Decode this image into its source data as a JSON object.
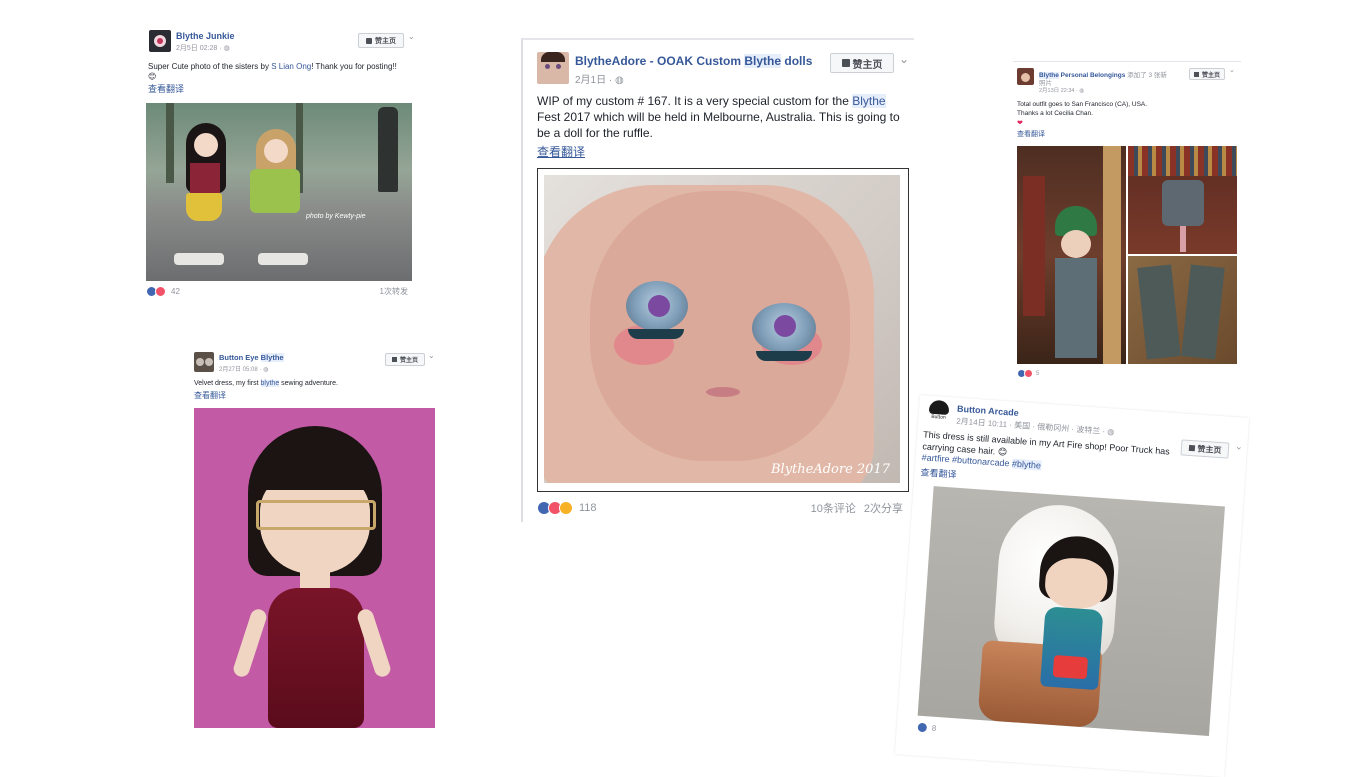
{
  "posts": {
    "junkie": {
      "name": "Blythe Junkie",
      "time": "2月5日 02:28 · ",
      "like_button": "赞主页",
      "text_before": "Super Cute photo of the sisters by ",
      "text_link": "S Lian Ong",
      "text_after": "! Thank you for posting!!",
      "emoji": "😊",
      "translate": "查看翻译",
      "photo_watermark": "photo by Kewty-pie",
      "reaction_count": "42",
      "shares": "1次转发"
    },
    "adore": {
      "name_pre": "BlytheAdore - OOAK Custom ",
      "name_hl": "Blythe",
      "name_post": " dolls",
      "time": "2月1日 · ",
      "like_button": "赞主页",
      "text_before": "WIP of my custom # 167. It is a very special custom for the ",
      "text_hl": "Blythe",
      "text_after": " Fest 2017 which will be held in Melbourne, Australia. This is going to be a doll for the ruffle.",
      "translate": "查看翻译",
      "photo_watermark": "BlytheAdore 2017",
      "reaction_count": "118",
      "comments": "10条评论",
      "shares": "2次分享"
    },
    "personal": {
      "name_hl": "Blythe",
      "name_post": " Personal Belongings",
      "added": "添加了 3 张新",
      "added2": "照片",
      "time": "2月13日 22:34 · ",
      "like_button": "赞主页",
      "line1": "Total outfit goes to San Francisco (CA), USA.",
      "line2": "Thanks a lot Cecilia Chan.",
      "heart": "❤",
      "translate": "查看翻译",
      "reaction_count": "5"
    },
    "buttoneye": {
      "name_pre": "Button Eye ",
      "name_hl": "Blythe",
      "time": "2月27日 05:08 · ",
      "like_button": "赞主页",
      "text_before": "Velvet dress, my first ",
      "text_hl": "blythe",
      "text_after": " sewing adventure.",
      "translate": "查看翻译"
    },
    "arcade": {
      "name": "Button Arcade",
      "avatar_label": "Button",
      "time": "2月14日 10:11 · 美国 · 俄勒冈州 · 波特兰 · ",
      "like_button": "赞主页",
      "text": "This dress is still available in my Art Fire shop! Poor Truck has carrying case hair.",
      "emoji": "😊",
      "tags": "#artfire #buttonarcade ",
      "tag_hl": "#blythe",
      "translate": "查看翻译",
      "reaction_count": "8"
    }
  },
  "colors": {
    "link": "#365899",
    "meta": "#90949c",
    "like": "#4267b2",
    "love": "#f25268",
    "wow": "#f7b125",
    "highlight": "#e7eefb"
  }
}
